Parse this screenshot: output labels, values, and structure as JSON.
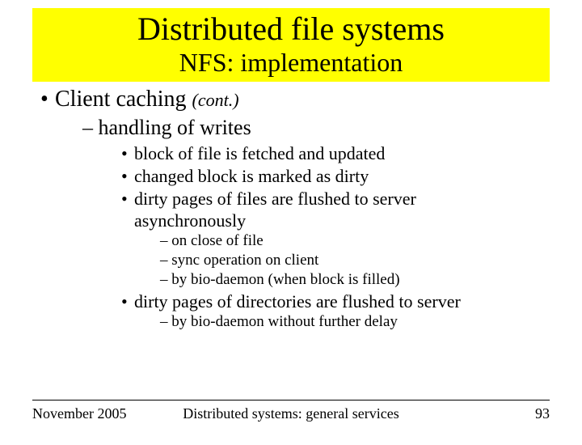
{
  "banner": {
    "title": "Distributed file systems",
    "subtitle": "NFS: implementation"
  },
  "content": {
    "l1_bullet": "•",
    "l1_text1": "Client  caching ",
    "l1_cont": "(cont.)",
    "l2_dash": "– ",
    "l2_a": "handling of writes",
    "l3_bullet": "•",
    "l3_a": "block of file is fetched and updated",
    "l3_b": "changed block is marked as dirty",
    "l3_c": "dirty pages of files are flushed to server",
    "l3_c2": "asynchronously",
    "l4_dash": "– ",
    "l4_a": "on close of file",
    "l4_b": "sync operation on client",
    "l4_c": "by bio-daemon (when block is filled)",
    "l3_d": "dirty pages of directories are flushed to server",
    "l4_d": "by bio-daemon without further delay"
  },
  "footer": {
    "left": "November 2005",
    "center": "Distributed systems: general services",
    "right": "93"
  }
}
